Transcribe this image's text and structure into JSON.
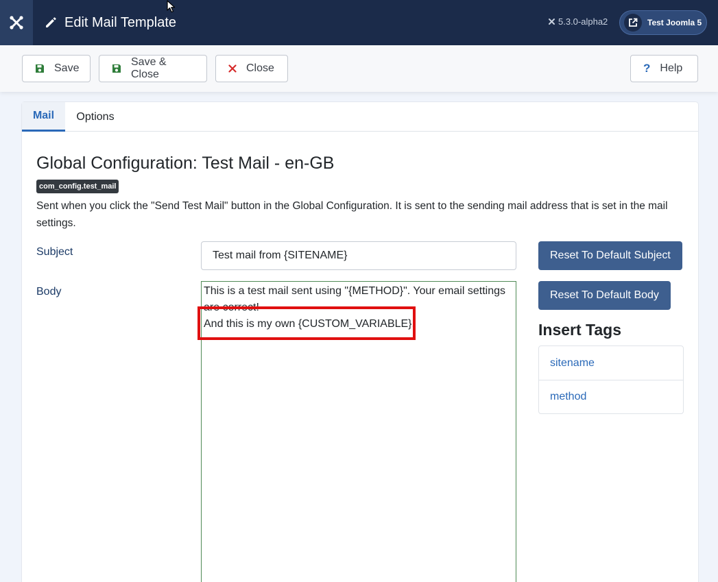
{
  "header": {
    "title": "Edit Mail Template",
    "version": "5.3.0-alpha2",
    "site_name": "Test Joomla 5",
    "colors": {
      "bar": "#1b2b4a",
      "logo_bg": "#2a3f63"
    }
  },
  "toolbar": {
    "save_label": "Save",
    "save_close_label": "Save & Close",
    "close_label": "Close",
    "help_label": "Help"
  },
  "tabs": [
    {
      "label": "Mail",
      "active": true
    },
    {
      "label": "Options",
      "active": false
    }
  ],
  "form": {
    "heading": "Global Configuration: Test Mail - en-GB",
    "template_key": "com_config.test_mail",
    "description": "Sent when you click the \"Send Test Mail\" button in the Global Configuration. It is sent to the sending mail address that is set in the mail settings.",
    "subject_label": "Subject",
    "subject_value": "Test mail from {SITENAME}",
    "body_label": "Body",
    "body_lines": [
      "This is a test mail sent using \"{METHOD}\". Your email settings are correct!",
      "And this is my own {CUSTOM_VARIABLE}!"
    ]
  },
  "sidebar": {
    "reset_subject_label": "Reset To Default Subject",
    "reset_body_label": "Reset To Default Body",
    "insert_tags_title": "Insert Tags",
    "tags": [
      "sitename",
      "method"
    ]
  },
  "colors": {
    "primary_button": "#3e5f8f",
    "link": "#2a69b8",
    "highlight_box": "#e01010",
    "save_icon": "#2f7d3a",
    "close_icon": "#d62b2b"
  }
}
